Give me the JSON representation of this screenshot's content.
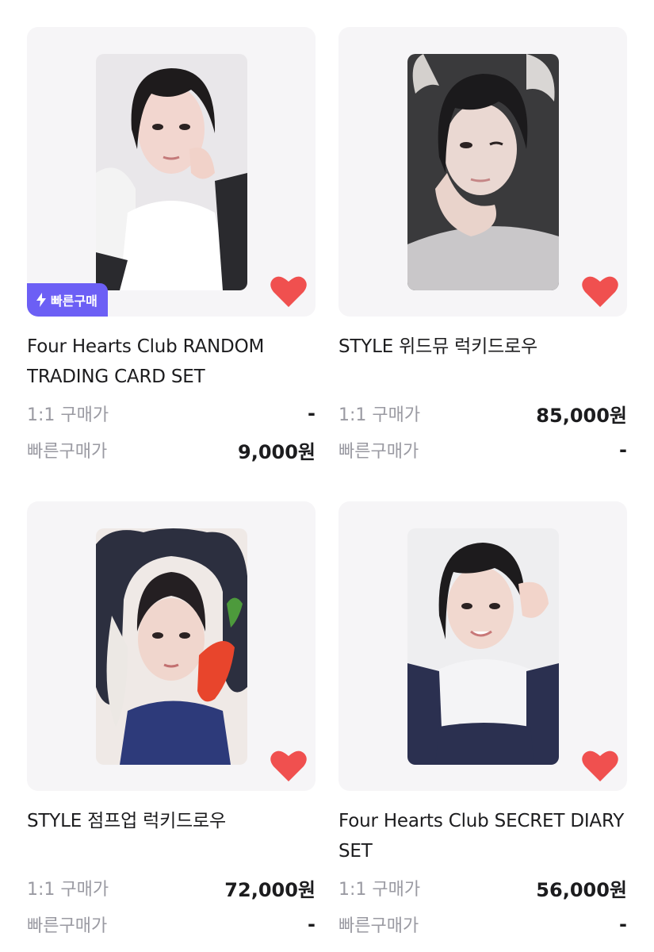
{
  "products": [
    {
      "title": "Four Hearts Club RANDOM TRADING CARD SET",
      "badge": "빠른구매",
      "prices": [
        {
          "label": "1:1 구매가",
          "value": "-"
        },
        {
          "label": "빠른구매가",
          "value": "9,000원"
        }
      ],
      "liked": true
    },
    {
      "title": "STYLE 위드뮤 럭키드로우",
      "prices": [
        {
          "label": "1:1 구매가",
          "value": "85,000원"
        },
        {
          "label": "빠른구매가",
          "value": "-"
        }
      ],
      "liked": true
    },
    {
      "title": "STYLE 점프업 럭키드로우",
      "prices": [
        {
          "label": "1:1 구매가",
          "value": "72,000원"
        },
        {
          "label": "빠른구매가",
          "value": "-"
        }
      ],
      "liked": true
    },
    {
      "title": "Four Hearts Club SECRET DIARY SET",
      "prices": [
        {
          "label": "1:1 구매가",
          "value": "56,000원"
        },
        {
          "label": "빠른구매가",
          "value": "-"
        }
      ],
      "liked": true
    }
  ],
  "colors": {
    "badge": "#6c5ff5",
    "heart": "#f0504f",
    "card_bg": "#f6f5f7",
    "label": "#9a9aa2"
  }
}
